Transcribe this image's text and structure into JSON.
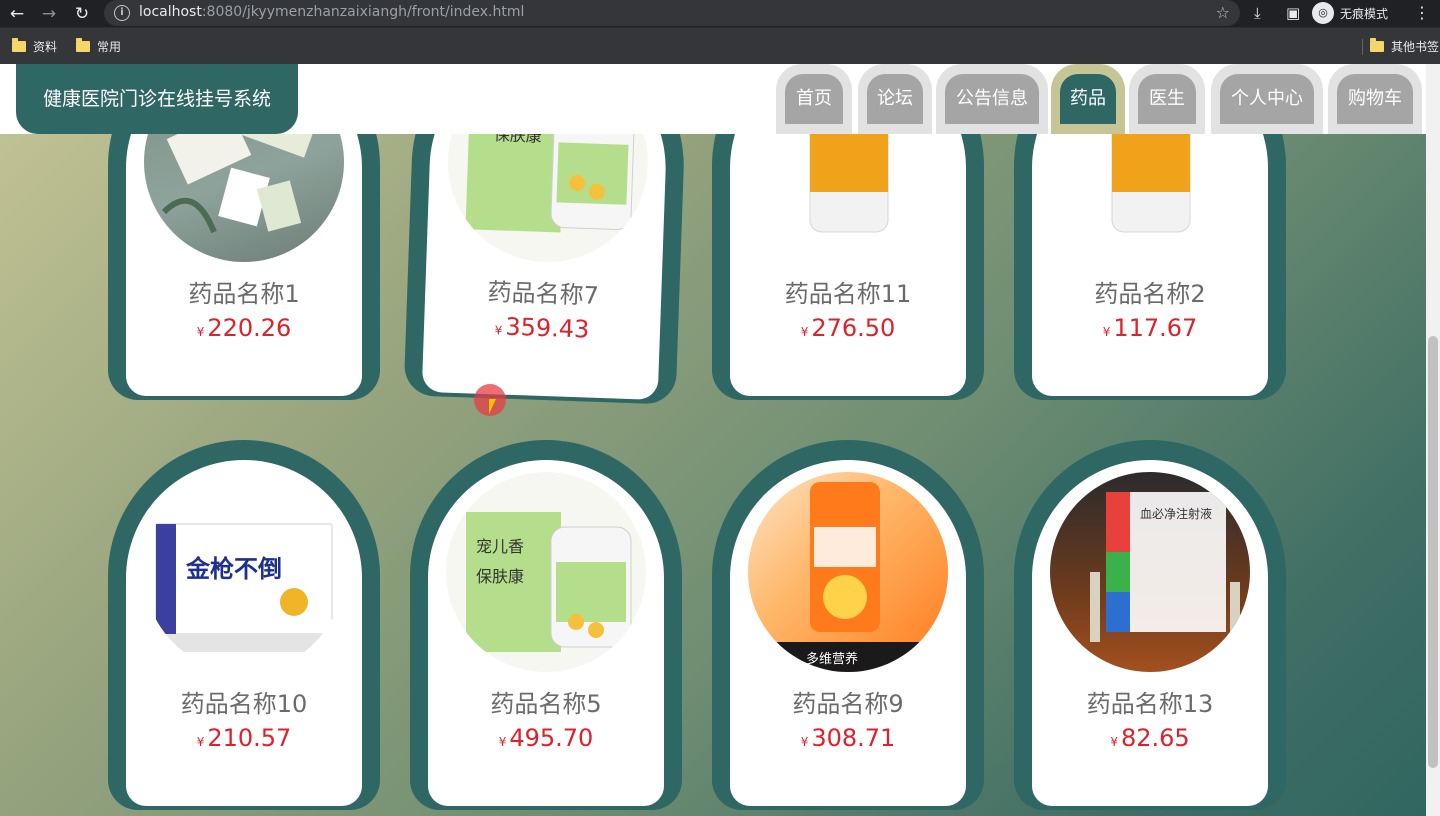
{
  "browser": {
    "url_host": "localhost",
    "url_rest": ":8080/jkyymenzhanzaixiangh/front/index.html",
    "incognito_label": "无痕模式",
    "bookmarks": [
      "资料",
      "常用"
    ],
    "other_bookmarks": "其他书签"
  },
  "site": {
    "title": "健康医院门诊在线挂号系统",
    "nav": [
      "首页",
      "论坛",
      "公告信息",
      "药品",
      "医生",
      "个人中心",
      "购物车"
    ],
    "active_nav": "药品"
  },
  "currency": "¥",
  "products": [
    {
      "name": "药品名称1",
      "price": "220.26"
    },
    {
      "name": "药品名称7",
      "price": "359.43"
    },
    {
      "name": "药品名称11",
      "price": "276.50"
    },
    {
      "name": "药品名称2",
      "price": "117.67"
    },
    {
      "name": "药品名称10",
      "price": "210.57"
    },
    {
      "name": "药品名称5",
      "price": "495.70"
    },
    {
      "name": "药品名称9",
      "price": "308.71"
    },
    {
      "name": "药品名称13",
      "price": "82.65"
    }
  ],
  "colors": {
    "brand": "#2e6763",
    "price": "#e0202a",
    "active_tab_ring": "#c5c596"
  }
}
